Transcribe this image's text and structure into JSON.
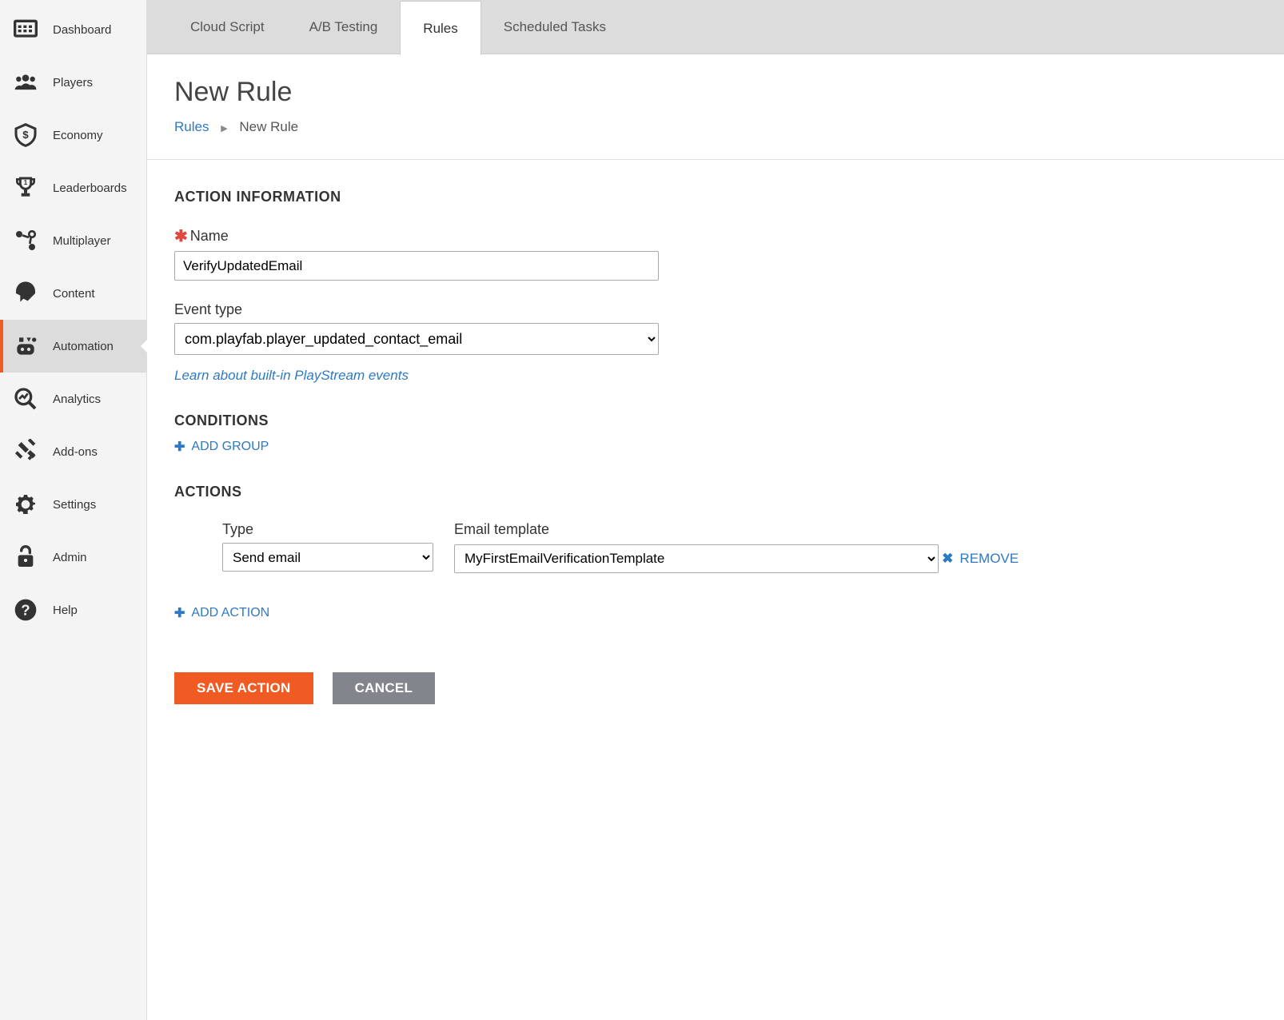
{
  "sidebar": {
    "items": [
      {
        "label": "Dashboard"
      },
      {
        "label": "Players"
      },
      {
        "label": "Economy"
      },
      {
        "label": "Leaderboards"
      },
      {
        "label": "Multiplayer"
      },
      {
        "label": "Content"
      },
      {
        "label": "Automation"
      },
      {
        "label": "Analytics"
      },
      {
        "label": "Add-ons"
      },
      {
        "label": "Settings"
      },
      {
        "label": "Admin"
      },
      {
        "label": "Help"
      }
    ]
  },
  "tabs": [
    {
      "label": "Cloud Script"
    },
    {
      "label": "A/B Testing"
    },
    {
      "label": "Rules"
    },
    {
      "label": "Scheduled Tasks"
    }
  ],
  "page": {
    "title": "New Rule",
    "breadcrumb": {
      "root": "Rules",
      "current": "New Rule"
    }
  },
  "actionInfo": {
    "heading": "ACTION INFORMATION",
    "nameLabel": "Name",
    "nameValue": "VerifyUpdatedEmail",
    "eventTypeLabel": "Event type",
    "eventTypeValue": "com.playfab.player_updated_contact_email",
    "learnLink": "Learn about built-in PlayStream events"
  },
  "conditions": {
    "heading": "CONDITIONS",
    "addGroup": "ADD GROUP"
  },
  "actions": {
    "heading": "ACTIONS",
    "typeLabel": "Type",
    "typeValue": "Send email",
    "templateLabel": "Email template",
    "templateValue": "MyFirstEmailVerificationTemplate",
    "remove": "REMOVE",
    "addAction": "ADD ACTION"
  },
  "buttons": {
    "save": "SAVE ACTION",
    "cancel": "CANCEL"
  }
}
